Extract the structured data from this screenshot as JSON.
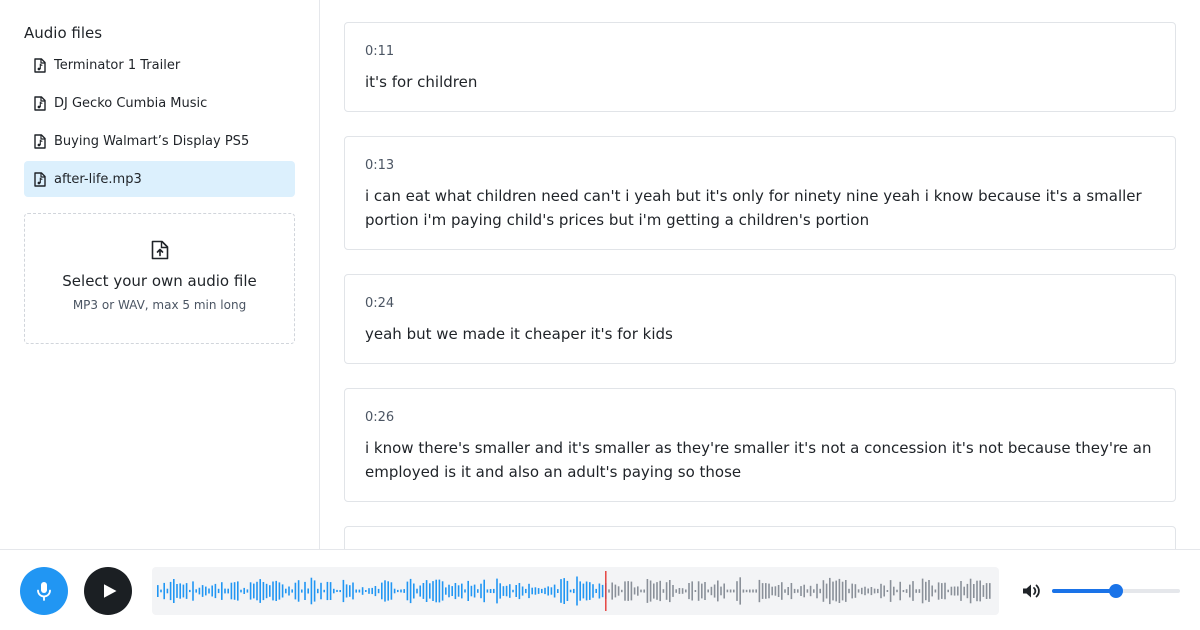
{
  "sidebar": {
    "title": "Audio files",
    "files": [
      {
        "label": "Terminator 1 Trailer",
        "selected": false
      },
      {
        "label": "DJ Gecko Cumbia Music",
        "selected": false
      },
      {
        "label": "Buying Walmart’s Display PS5",
        "selected": false
      },
      {
        "label": "after-life.mp3",
        "selected": true
      }
    ],
    "upload": {
      "title": "Select your own audio file",
      "subtitle": "MP3 or WAV, max 5 min long",
      "icon": "file-upload-icon"
    }
  },
  "transcript": [
    {
      "time": "0:11",
      "text": "it's for children"
    },
    {
      "time": "0:13",
      "text": "i can eat what children need can't i yeah but it's only for ninety nine yeah i know because it's a smaller portion i'm paying child's prices but i'm getting a children's portion"
    },
    {
      "time": "0:24",
      "text": "yeah but we made it cheaper it's for kids"
    },
    {
      "time": "0:26",
      "text": "i know there's smaller and it's smaller as they're smaller it's not a concession it's not because they're an employed is it and also an adult's paying so those"
    },
    {
      "time": "",
      "text": ""
    }
  ],
  "player": {
    "mic_icon": "microphone-icon",
    "play_icon": "play-icon",
    "volume_icon": "volume-icon",
    "progress": 0.535,
    "volume": 0.5,
    "colors": {
      "mic": "#2196f3",
      "play": "#1b1f23",
      "played": "#2196f3",
      "unplayed": "#8a9099",
      "cursor": "#e53935",
      "volume": "#1a73e8",
      "selected_bg": "#dcf0fd"
    }
  }
}
